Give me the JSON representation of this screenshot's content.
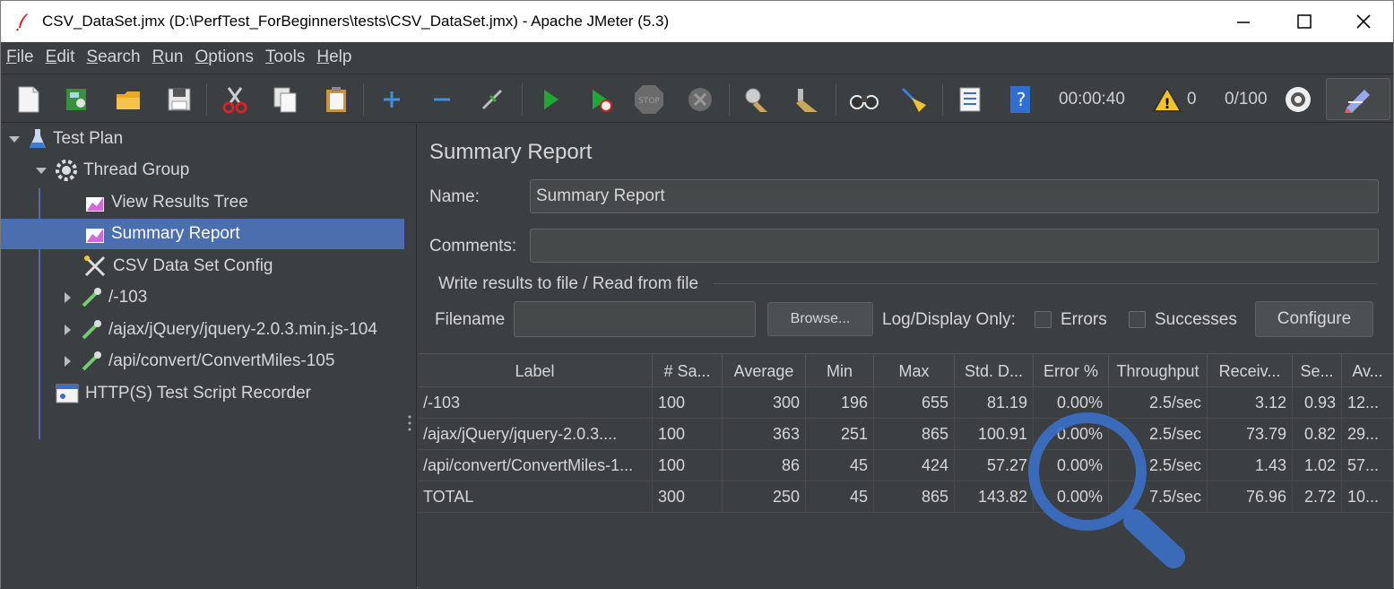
{
  "window": {
    "title": "CSV_DataSet.jmx (D:\\PerfTest_ForBeginners\\tests\\CSV_DataSet.jmx) - Apache JMeter (5.3)"
  },
  "menu": [
    {
      "label_u": "F",
      "label_rest": "ile"
    },
    {
      "label_u": "E",
      "label_rest": "dit"
    },
    {
      "label_u": "S",
      "label_rest": "earch"
    },
    {
      "label_u": "R",
      "label_rest": "un"
    },
    {
      "label_u": "O",
      "label_rest": "ptions"
    },
    {
      "label_u": "T",
      "label_rest": "ools"
    },
    {
      "label_u": "H",
      "label_rest": "elp"
    }
  ],
  "toolbar": {
    "timer": "00:00:40",
    "warnings": "0",
    "threads": "0/100"
  },
  "tree": {
    "test_plan": "Test Plan",
    "thread_group": "Thread Group",
    "view_results_tree": "View Results Tree",
    "summary_report": "Summary Report",
    "csv_config": "CSV Data Set Config",
    "sampler1": "/-103",
    "sampler2": "/ajax/jQuery/jquery-2.0.3.min.js-104",
    "sampler3": "/api/convert/ConvertMiles-105",
    "recorder": "HTTP(S) Test Script Recorder"
  },
  "panel": {
    "title": "Summary Report",
    "name_label": "Name:",
    "name_value": "Summary Report",
    "comments_label": "Comments:",
    "comments_value": "",
    "group_title": "Write results to file / Read from file",
    "filename_label": "Filename",
    "filename_value": "",
    "browse": "Browse...",
    "log_only": "Log/Display Only:",
    "errors": "Errors",
    "successes": "Successes",
    "configure": "Configure"
  },
  "table": {
    "headers": [
      "Label",
      "# Sa...",
      "Average",
      "Min",
      "Max",
      "Std. D...",
      "Error %",
      "Throughput",
      "Receiv...",
      "Se...",
      "Av..."
    ],
    "rows": [
      [
        "/-103",
        "100",
        "300",
        "196",
        "655",
        "81.19",
        "0.00%",
        "2.5/sec",
        "3.12",
        "0.93",
        "12..."
      ],
      [
        "/ajax/jQuery/jquery-2.0.3....",
        "100",
        "363",
        "251",
        "865",
        "100.91",
        "0.00%",
        "2.5/sec",
        "73.79",
        "0.82",
        "29..."
      ],
      [
        "/api/convert/ConvertMiles-1...",
        "100",
        "86",
        "45",
        "424",
        "57.27",
        "0.00%",
        "2.5/sec",
        "1.43",
        "1.02",
        "57..."
      ],
      [
        "TOTAL",
        "300",
        "250",
        "45",
        "865",
        "143.82",
        "0.00%",
        "7.5/sec",
        "76.96",
        "2.72",
        "10..."
      ]
    ]
  },
  "colors": {
    "background": "#3c3f41",
    "selection": "#4b6eaf",
    "magnifier": "#3a6fc4"
  }
}
